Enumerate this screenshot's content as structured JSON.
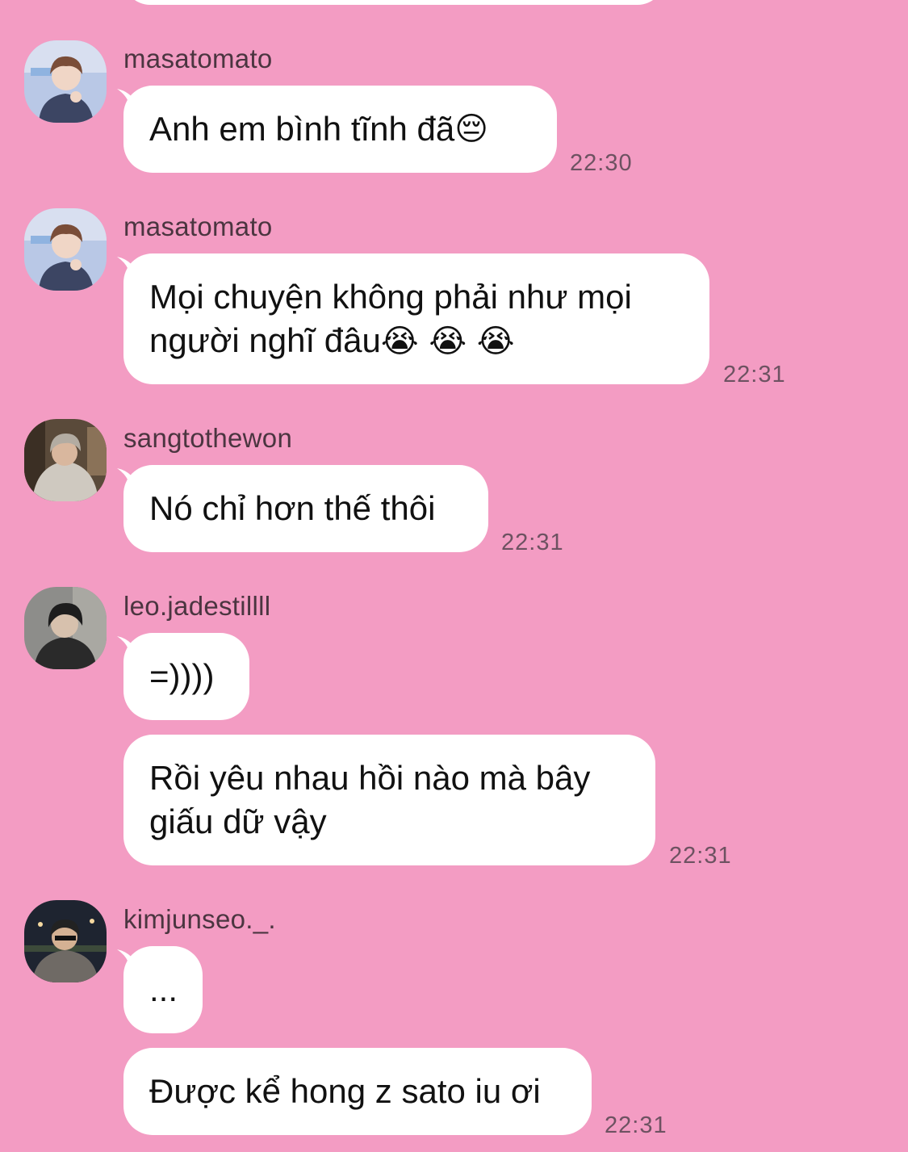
{
  "colors": {
    "background": "#f39cc3",
    "bubble": "#ffffff",
    "time": "#6d5261",
    "username": "#4b3540"
  },
  "messages": [
    {
      "sender": "masatomato",
      "text": "Anh em bình tĩnh đã",
      "emoji": "😔",
      "time": "22:30"
    },
    {
      "sender": "masatomato",
      "text": "Mọi chuyện không phải như mọi\nngười nghĩ đâu",
      "emoji": "😭 😭 😭",
      "time": "22:31"
    },
    {
      "sender": "sangtothewon",
      "text": "Nó chỉ hơn thế thôi",
      "time": "22:31"
    },
    {
      "sender": "leo.jadestillll",
      "text": "=))))"
    },
    {
      "text": "Rồi yêu nhau hồi nào mà bây\ngiấu dữ vậy",
      "time": "22:31"
    },
    {
      "sender": "kimjunseo._.",
      "text": "..."
    },
    {
      "text": "Được kể hong z sato iu ơi",
      "time": "22:31"
    }
  ]
}
